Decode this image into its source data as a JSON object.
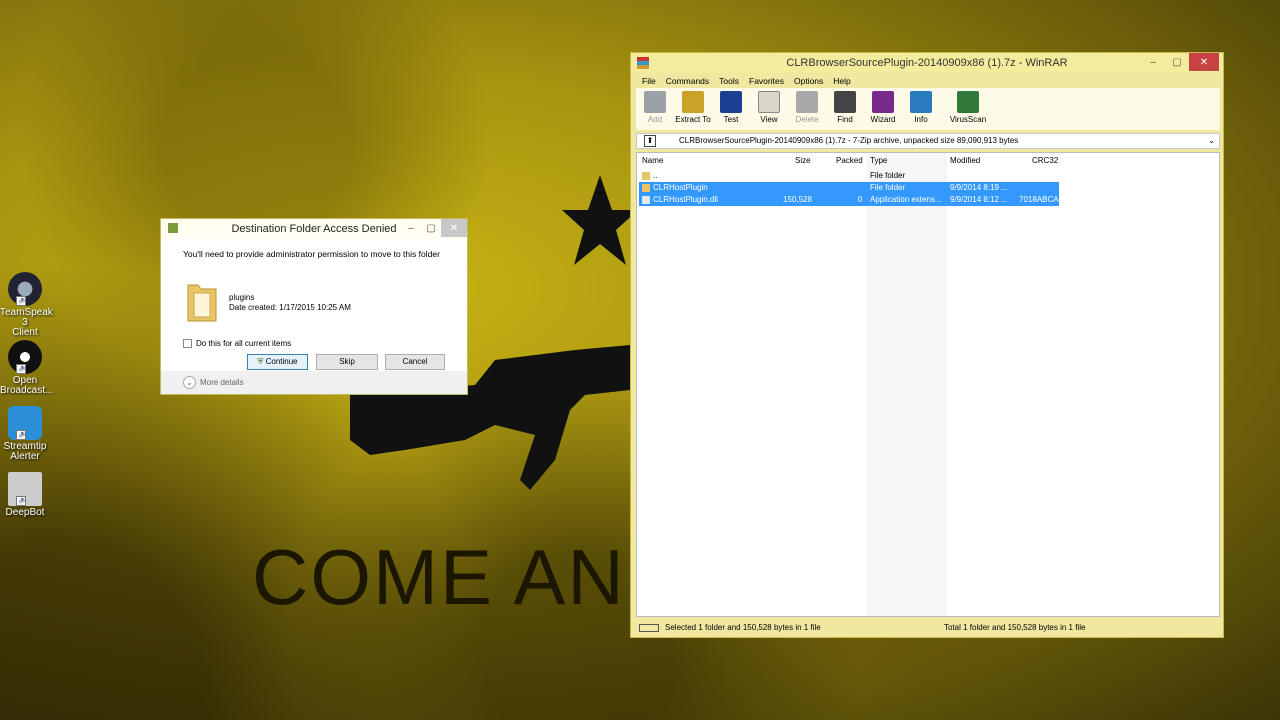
{
  "wallpaper": {
    "text": "COME AN"
  },
  "desktop_icons": [
    {
      "label_line1": "TeamSpeak 3",
      "label_line2": "Client",
      "icon": "teamspeak-icon"
    },
    {
      "label_line1": "Open",
      "label_line2": "Broadcast...",
      "icon": "obs-icon"
    },
    {
      "label_line1": "Streamtip",
      "label_line2": "Alerter",
      "icon": "streamtip-icon"
    },
    {
      "label_line1": "DeepBot",
      "label_line2": "",
      "icon": "deepbot-icon"
    }
  ],
  "dialog": {
    "title": "Destination Folder Access Denied",
    "message": "You'll need to provide administrator permission to move to this folder",
    "folder_name": "plugins",
    "folder_date": "Date created: 1/17/2015 10:25 AM",
    "checkbox_label": "Do this for all current items",
    "continue_label": "Continue",
    "skip_label": "Skip",
    "cancel_label": "Cancel",
    "more_details": "More details"
  },
  "winrar": {
    "title": "CLRBrowserSourcePlugin-20140909x86 (1).7z - WinRAR",
    "menu": [
      "File",
      "Commands",
      "Tools",
      "Favorites",
      "Options",
      "Help"
    ],
    "tools": [
      {
        "label": "Add",
        "disabled": true,
        "color": "#9aa0a6"
      },
      {
        "label": "Extract To",
        "disabled": false,
        "color": "#c9a227"
      },
      {
        "label": "Test",
        "disabled": false,
        "color": "#1c3f94"
      },
      {
        "label": "View",
        "disabled": false,
        "color": "#d8d8c8"
      },
      {
        "label": "Delete",
        "disabled": true,
        "color": "#a9a9a9"
      },
      {
        "label": "Find",
        "disabled": false,
        "color": "#444444"
      },
      {
        "label": "Wizard",
        "disabled": false,
        "color": "#7a2a8c"
      },
      {
        "label": "Info",
        "disabled": false,
        "color": "#2a7ac0"
      },
      {
        "label": "VirusScan",
        "disabled": false,
        "color": "#2f7a3a"
      }
    ],
    "address": "CLRBrowserSourcePlugin-20140909x86 (1).7z - 7-Zip archive, unpacked size 89,090,913 bytes",
    "columns": [
      "Name",
      "Size",
      "Packed",
      "Type",
      "Modified",
      "CRC32"
    ],
    "rows": [
      {
        "name": "..",
        "size": "",
        "packed": "",
        "type": "File folder",
        "modified": "",
        "crc": "",
        "selected": false
      },
      {
        "name": "CLRHostPlugin",
        "size": "",
        "packed": "",
        "type": "File folder",
        "modified": "9/9/2014 8:19 ...",
        "crc": "",
        "selected": true
      },
      {
        "name": "CLRHostPlugin.dll",
        "size": "150,528",
        "packed": "0",
        "type": "Application extens...",
        "modified": "9/9/2014 8:12 ...",
        "crc": "7018ABCA",
        "selected": true
      }
    ],
    "status_left": "Selected 1 folder and 150,528 bytes in 1 file",
    "status_right": "Total 1 folder and 150,528 bytes in 1 file"
  }
}
